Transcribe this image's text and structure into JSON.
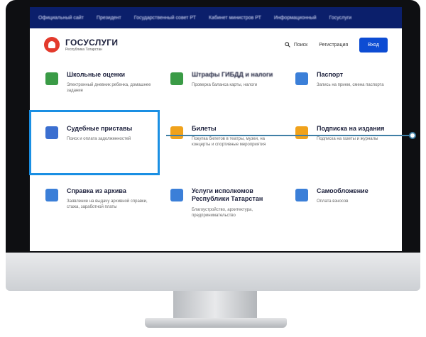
{
  "topnav": {
    "items": [
      "Официальный сайт",
      "Президент",
      "Государственный совет РТ",
      "Кабинет министров РТ",
      "Информационный",
      "Госуслуги"
    ]
  },
  "header": {
    "logo_title": "ГОСУСЛУГИ",
    "logo_subtitle": "Республика Татарстан",
    "search_label": "Поиск",
    "register_label": "Регистрация",
    "login_label": "Вход"
  },
  "services": [
    {
      "title": "Школьные оценки",
      "desc": "Электронный дневник ребенка, домашнее задание",
      "icon": "book-icon",
      "color": "#3a9b46"
    },
    {
      "title": "Штрафы ГИБДД и налоги",
      "desc": "Проверка баланса карты, налоги",
      "icon": "car-icon",
      "color": "#3a9b46"
    },
    {
      "title": "Паспорт",
      "desc": "Запись на прием, смена паспорта",
      "icon": "passport-icon",
      "color": "#3b7fd8"
    },
    {
      "title": "Судебные приставы",
      "desc": "Поиск и оплата задолженностей",
      "icon": "bailiff-icon",
      "color": "#3b6fd0"
    },
    {
      "title": "Билеты",
      "desc": "Покупка билетов в театры, музеи, на концерты и спортивные мероприятия",
      "icon": "ticket-icon",
      "color": "#f0a21b"
    },
    {
      "title": "Подписка на издания",
      "desc": "Подписка на газеты и журналы",
      "icon": "newspaper-icon",
      "color": "#f0a21b"
    },
    {
      "title": "Справка из архива",
      "desc": "Заявление на выдачу архивной справки, стажа, заработной платы",
      "icon": "archive-icon",
      "color": "#3b7fd8"
    },
    {
      "title": "Услуги исполкомов Республики Татарстан",
      "desc": "Благоустройство, архитектура, предпринимательство",
      "icon": "building-icon",
      "color": "#3b7fd8"
    },
    {
      "title": "Самообложение",
      "desc": "Оплата взносов",
      "icon": "hand-icon",
      "color": "#3b7fd8"
    }
  ],
  "highlighted_service": "Судебные приставы"
}
